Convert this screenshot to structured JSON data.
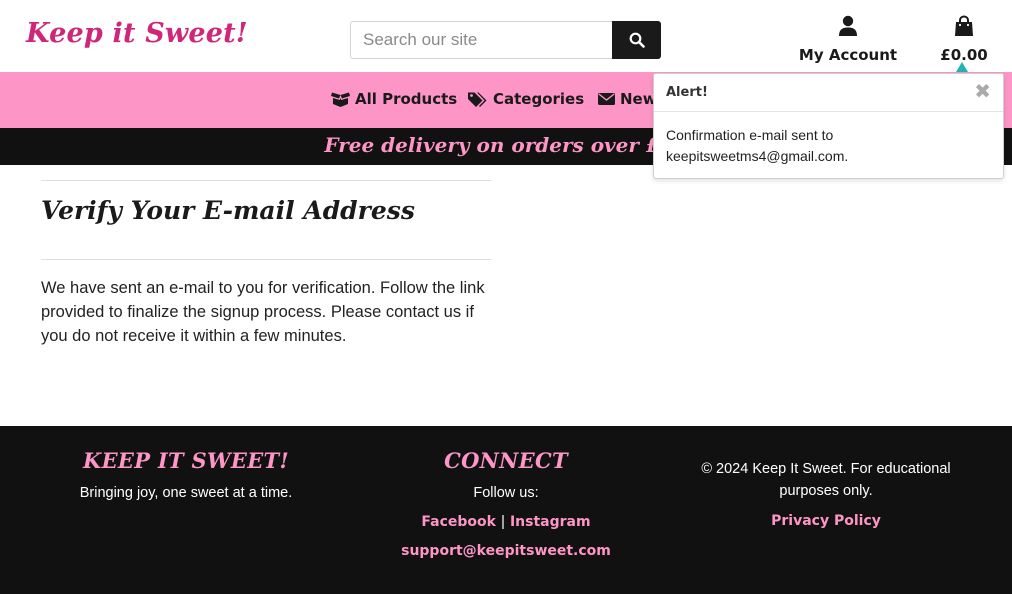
{
  "colors": {
    "accent_pink": "#fd95c6",
    "brand_pink": "#d0267a",
    "dark": "#111111"
  },
  "header": {
    "logo": "Keep it Sweet!",
    "search": {
      "placeholder": "Search our site",
      "icon": "search-icon"
    },
    "account": {
      "label": "My Account",
      "icon": "user-icon"
    },
    "cart": {
      "label": "£0.00",
      "icon": "shopping-bag-icon"
    }
  },
  "nav": [
    {
      "label": "All Products",
      "icon": "box-open-icon"
    },
    {
      "label": "Categories",
      "icon": "tags-icon"
    },
    {
      "label": "New",
      "icon": "envelope-icon"
    }
  ],
  "banner": {
    "text": "Free delivery on orders over £50"
  },
  "main": {
    "title": "Verify Your E-mail Address",
    "body": "We have sent an e-mail to you for verification. Follow the link provided to finalize the signup process. Please contact us if you do not receive it within a few minutes."
  },
  "alert": {
    "title": "Alert!",
    "close": "✖",
    "message": "Confirmation e-mail sent to keepitsweetms4@gmail.com."
  },
  "footer": {
    "brand": {
      "heading": "KEEP IT SWEET!",
      "tagline": "Bringing joy, one sweet at a time."
    },
    "connect": {
      "heading": "CONNECT",
      "follow": "Follow us:",
      "facebook": "Facebook",
      "separator": "|",
      "instagram": "Instagram",
      "email": "support@keepitsweet.com"
    },
    "legal": {
      "copyright": "© 2024 Keep It Sweet. For educational purposes only.",
      "privacy": "Privacy Policy"
    }
  }
}
